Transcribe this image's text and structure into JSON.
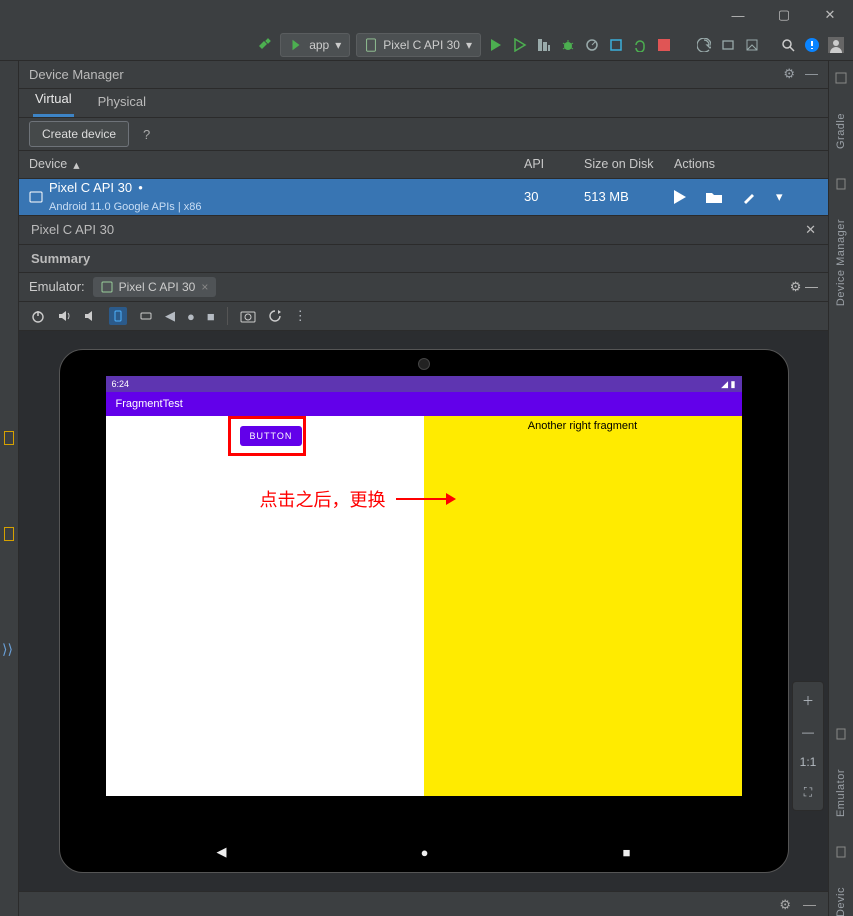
{
  "toolbar": {
    "app_drop": "app",
    "device_drop": "Pixel C API 30"
  },
  "panel": {
    "title": "Device Manager"
  },
  "tabs": {
    "virtual": "Virtual",
    "physical": "Physical"
  },
  "create": {
    "label": "Create device"
  },
  "columns": {
    "device": "Device",
    "api": "API",
    "size": "Size on Disk",
    "actions": "Actions"
  },
  "device": {
    "name": "Pixel C API 30",
    "sub": "Android 11.0 Google APIs | x86",
    "api": "30",
    "size": "513 MB"
  },
  "sub": {
    "title": "Pixel C API 30"
  },
  "summary": {
    "label": "Summary"
  },
  "emulator": {
    "label": "Emulator:",
    "chip": "Pixel C API 30"
  },
  "android": {
    "time": "6:24",
    "app_title": "FragmentTest",
    "button": "BUTTON",
    "right_text": "Another right fragment"
  },
  "annotation": {
    "text": "点击之后，更换"
  },
  "emuside": {
    "fit": "1:1"
  },
  "rightgut": {
    "gradle": "Gradle",
    "device_manager": "Device Manager",
    "emulator": "Emulator",
    "devic": "Devic"
  }
}
